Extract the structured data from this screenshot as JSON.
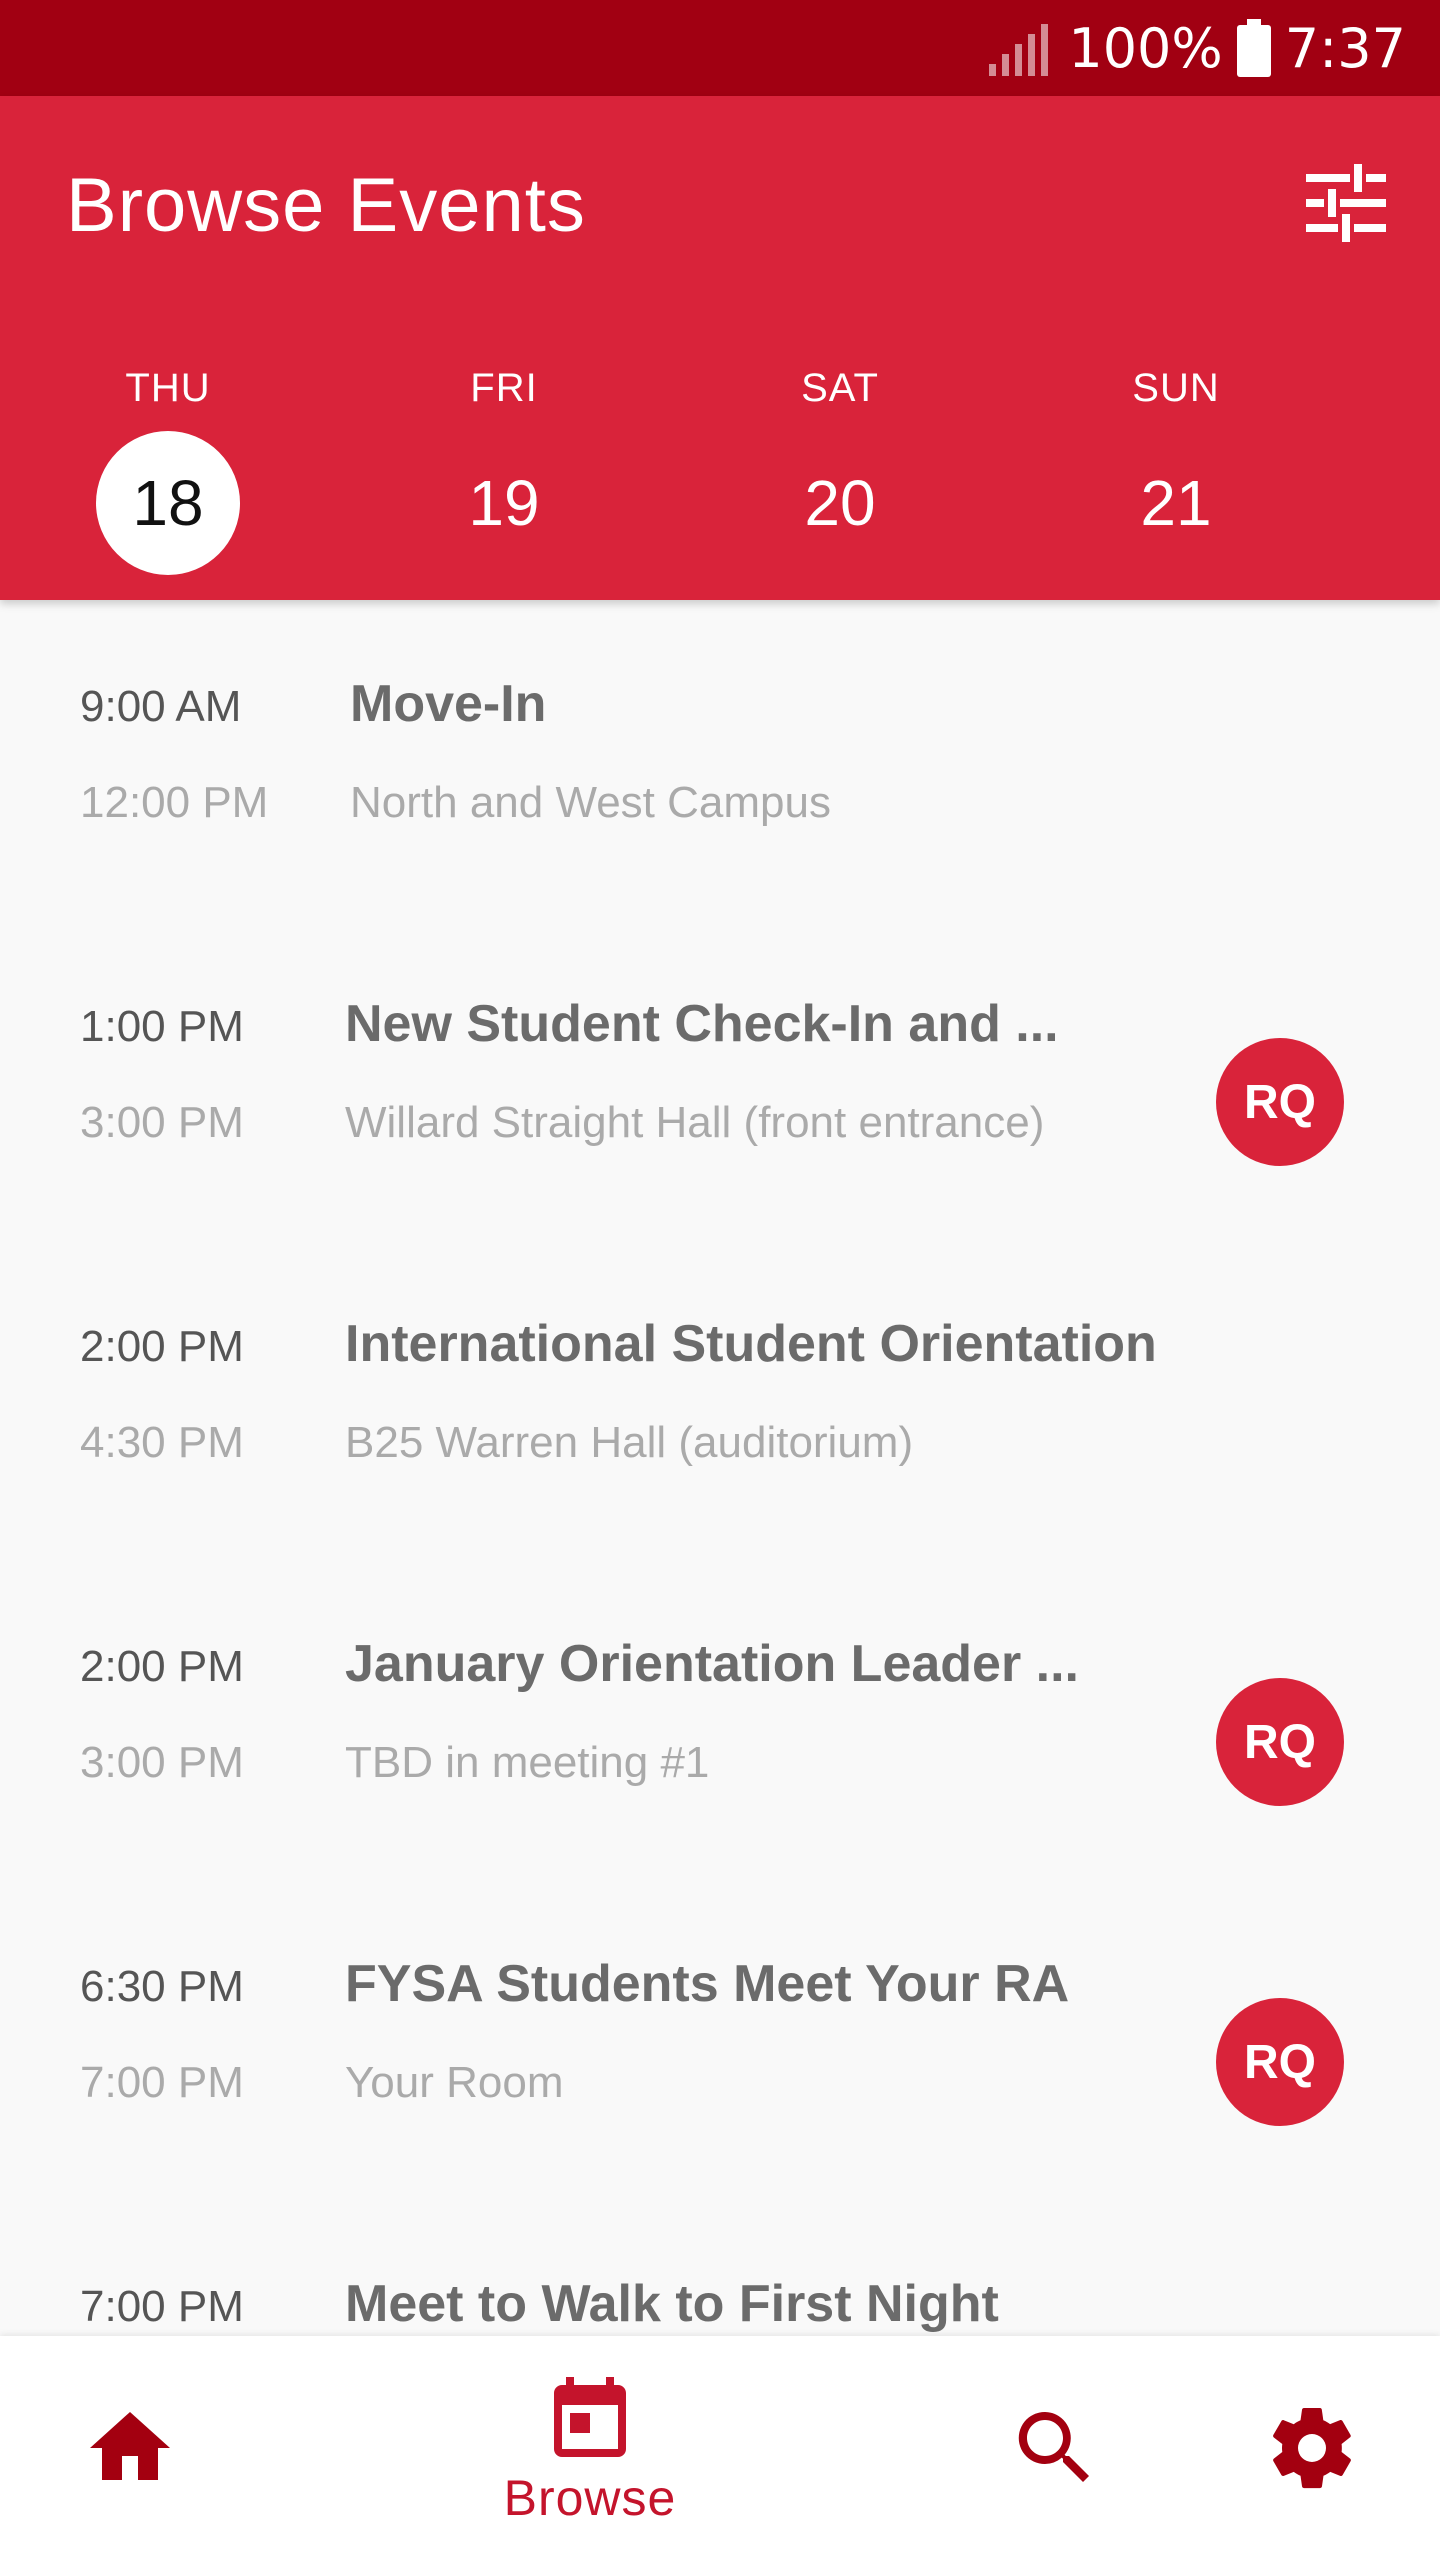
{
  "status_bar": {
    "battery": "100%",
    "time": "7:37"
  },
  "header": {
    "title": "Browse Events",
    "filter_icon": "tune-icon"
  },
  "days": [
    {
      "name": "THU",
      "num": "18",
      "selected": true
    },
    {
      "name": "FRI",
      "num": "19",
      "selected": false
    },
    {
      "name": "SAT",
      "num": "20",
      "selected": false
    },
    {
      "name": "SUN",
      "num": "21",
      "selected": false
    }
  ],
  "events": [
    {
      "start": "9:00 AM",
      "end": "12:00 PM",
      "title": "Move-In",
      "location": "North and West Campus",
      "badge": ""
    },
    {
      "start": "1:00 PM",
      "end": "3:00 PM",
      "title": "New Student Check-In and ...",
      "location": "Willard Straight Hall (front entrance)",
      "badge": "RQ"
    },
    {
      "start": "2:00 PM",
      "end": "4:30 PM",
      "title": "International Student Orientation",
      "location": "B25 Warren Hall (auditorium)",
      "badge": ""
    },
    {
      "start": "2:00 PM",
      "end": "3:00 PM",
      "title": "January Orientation Leader ...",
      "location": "TBD in meeting #1",
      "badge": "RQ"
    },
    {
      "start": "6:30 PM",
      "end": "7:00 PM",
      "title": "FYSA Students Meet Your RA",
      "location": "Your Room",
      "badge": "RQ"
    },
    {
      "start": "7:00 PM",
      "end": "",
      "title": "Meet to Walk to First Night",
      "location": "",
      "badge": ""
    }
  ],
  "bottom_nav": {
    "home_icon": "home-icon",
    "browse_icon": "calendar-icon",
    "browse_label": "Browse",
    "search_icon": "search-icon",
    "settings_icon": "gear-icon"
  },
  "colors": {
    "primary": "#d9233a",
    "status_bar": "#a10012",
    "nav_accent": "#c4142c",
    "nav_dark": "#a30010"
  }
}
